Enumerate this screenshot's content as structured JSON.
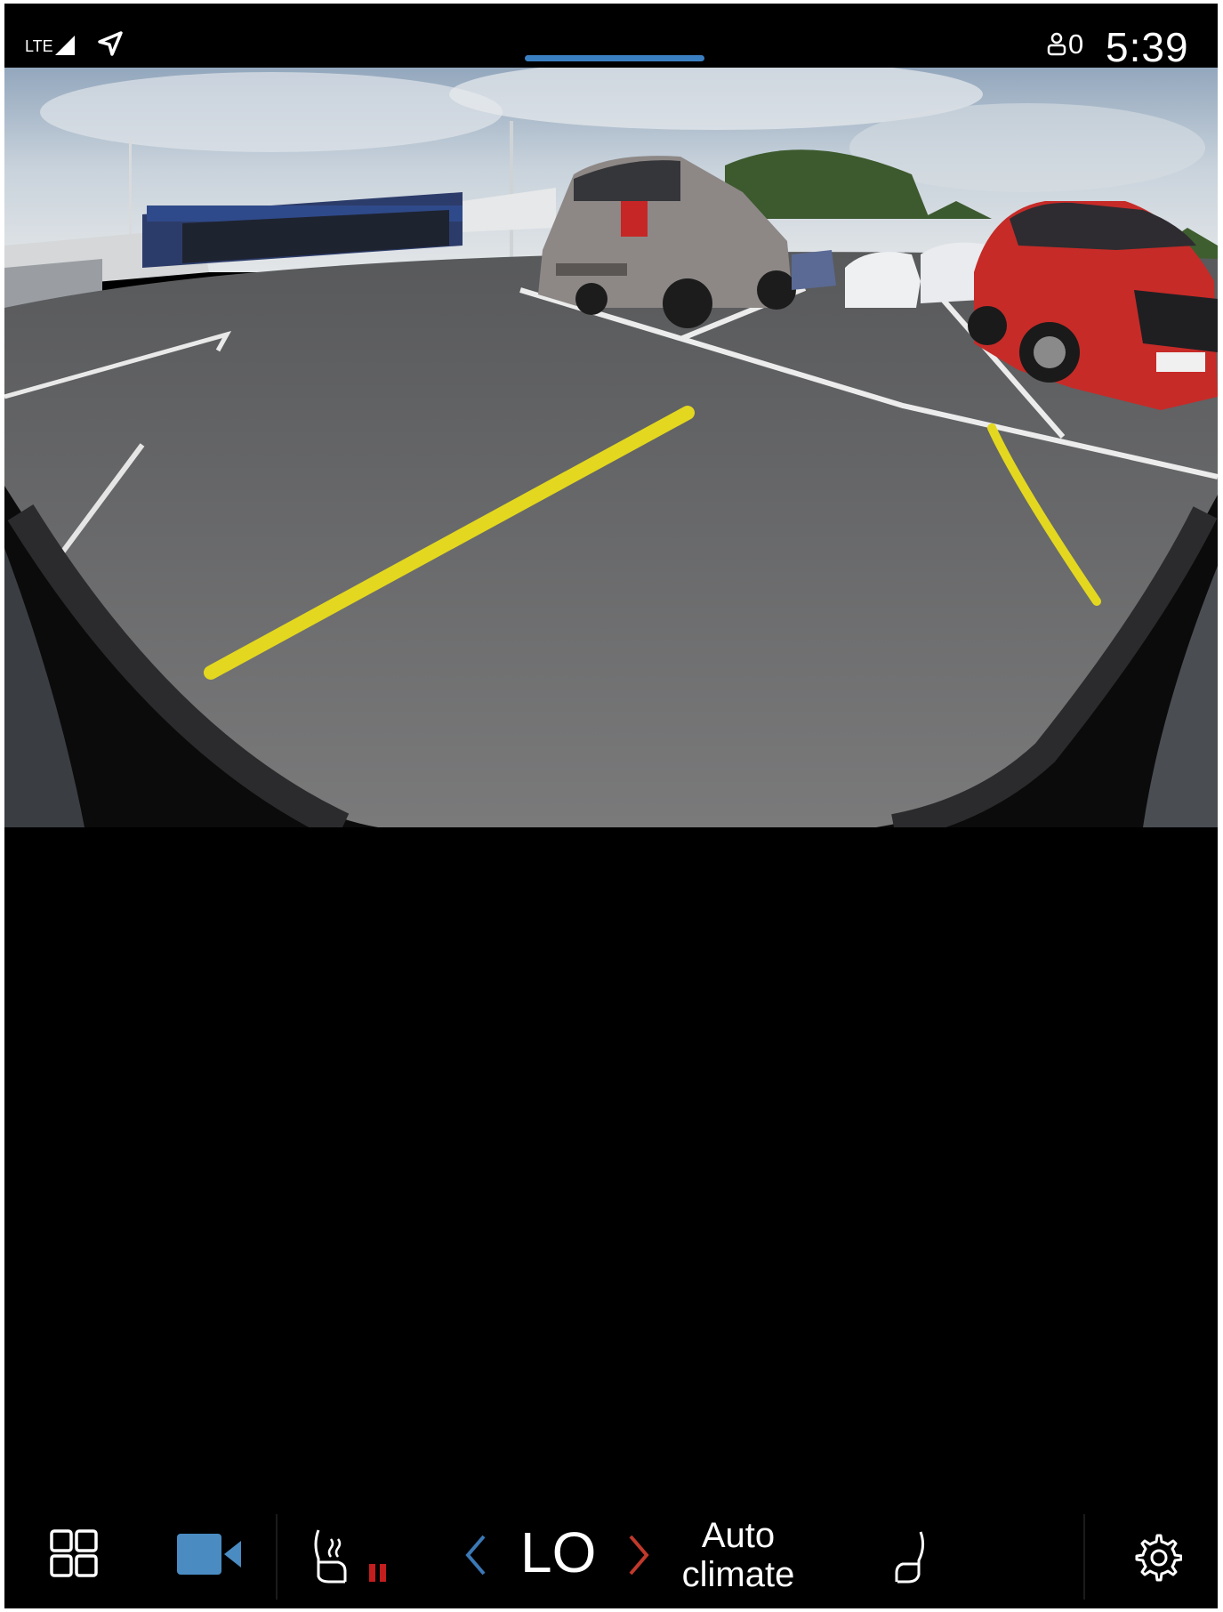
{
  "status_bar": {
    "network": "LTE",
    "user_count": "0",
    "time": "5:39"
  },
  "camera_view": {
    "label": "Rear parking camera view",
    "guide_line_color": "#e3d81f"
  },
  "climate_bar": {
    "apps_icon": "grid-icon",
    "camera_icon": "video-camera-icon",
    "seat_heat_icon": "seat-heat-icon",
    "temperature": "LO",
    "auto_climate_line1": "Auto",
    "auto_climate_line2": "climate",
    "passenger_seat_icon": "seat-icon",
    "settings_icon": "gear-icon"
  },
  "colors": {
    "accent_blue": "#3a7fc1",
    "camera_icon_blue": "#4a8cc2",
    "temp_down_blue": "#3b78b6",
    "temp_up_red": "#c0392b",
    "seat_heat_red": "#c41d1d"
  }
}
